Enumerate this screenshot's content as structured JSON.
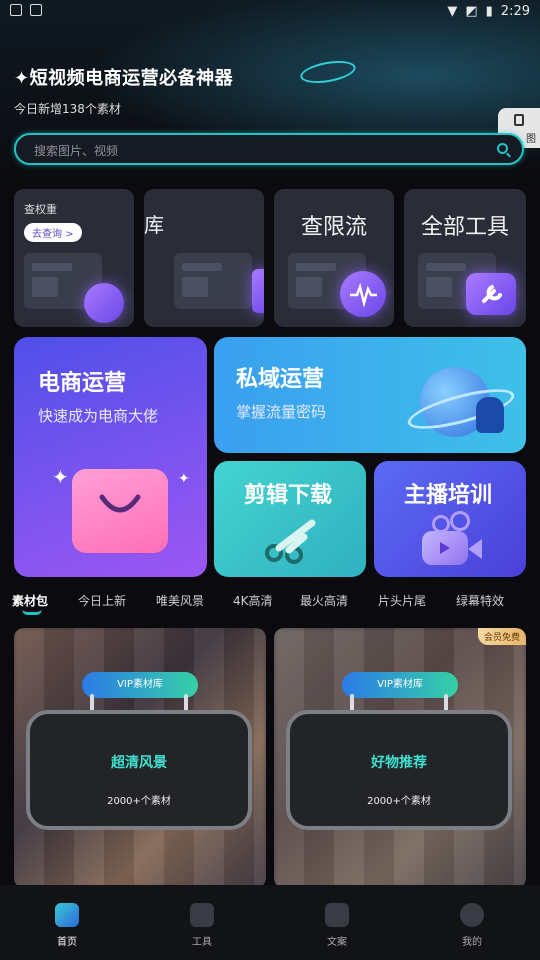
{
  "status_bar": {
    "time": "2:29"
  },
  "header": {
    "title": "✦短视频电商运营必备神器",
    "subtitle": "今日新增138个素材",
    "side_tab_label": "图"
  },
  "search": {
    "placeholder": "搜索图片、视频"
  },
  "tools": [
    {
      "label": "",
      "small_label": "查权重",
      "pill": "去查询 >"
    },
    {
      "label": "库"
    },
    {
      "label": "查限流"
    },
    {
      "label": "全部工具"
    }
  ],
  "promos": {
    "ecommerce": {
      "title": "电商运营",
      "subtitle": "快速成为电商大佬"
    },
    "private": {
      "title": "私域运营",
      "subtitle": "掌握流量密码"
    },
    "edit": {
      "title": "剪辑下载"
    },
    "anchor": {
      "title": "主播培训"
    }
  },
  "categories": [
    "素材包",
    "今日上新",
    "唯美风景",
    "4K高清",
    "最火高清",
    "片头片尾",
    "绿幕特效"
  ],
  "cards": [
    {
      "badge": "VIP素材库",
      "title": "超清风景",
      "count": "2000+个素材",
      "corner": ""
    },
    {
      "badge": "VIP素材库",
      "title": "好物推荐",
      "count": "2000+个素材",
      "corner": "会员免费"
    }
  ],
  "nav": [
    {
      "label": "首页"
    },
    {
      "label": "工具"
    },
    {
      "label": "文案"
    },
    {
      "label": "我的"
    }
  ],
  "colors": {
    "accent": "#22c3c5",
    "purple": "#7a5cff",
    "blue": "#3a7bf0"
  }
}
